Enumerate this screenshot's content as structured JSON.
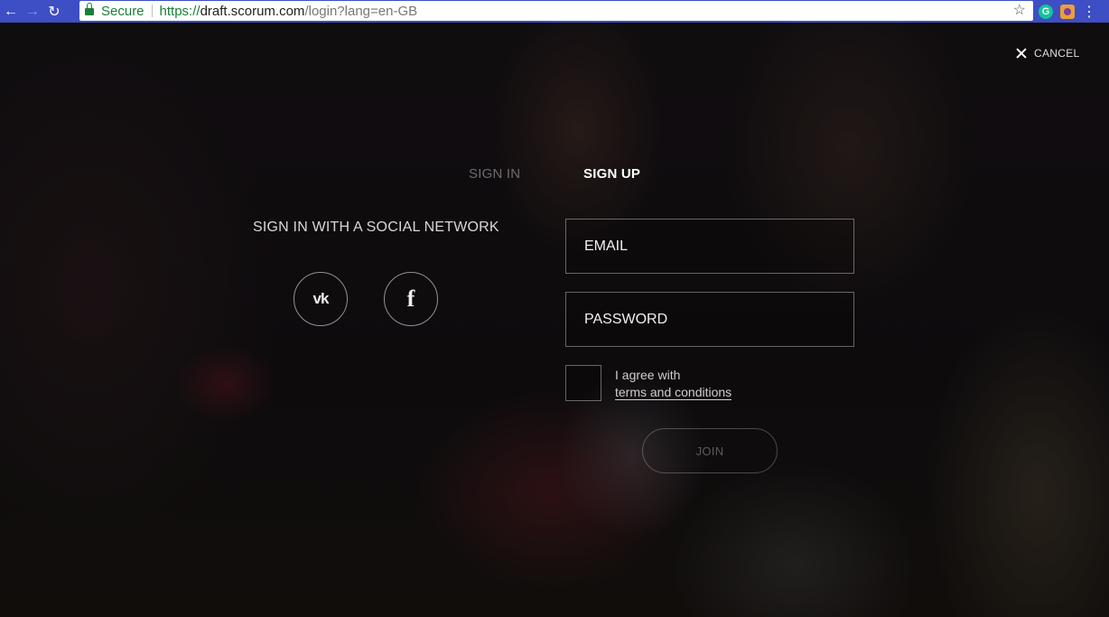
{
  "browser": {
    "secure_label": "Secure",
    "url_scheme": "https://",
    "url_host": "draft.scorum.com",
    "url_path": "/login?lang=en-GB",
    "extension_g_label": "G"
  },
  "modal": {
    "cancel_label": "CANCEL",
    "tabs": [
      {
        "label": "SIGN IN",
        "active": false
      },
      {
        "label": "SIGN UP",
        "active": true
      }
    ],
    "social": {
      "title": "SIGN IN WITH A SOCIAL NETWORK",
      "vk_label": "vk",
      "facebook_label": "f"
    },
    "form": {
      "email_placeholder": "EMAIL",
      "password_placeholder": "PASSWORD",
      "agree_text": "I agree with",
      "terms_link": "terms and conditions",
      "join_label": "JOIN"
    }
  },
  "colors": {
    "browser_bar": "#3e4ec4",
    "secure_green": "#188038",
    "active_tab": "#ffffff",
    "inactive_tab": "#6e6a6e"
  }
}
